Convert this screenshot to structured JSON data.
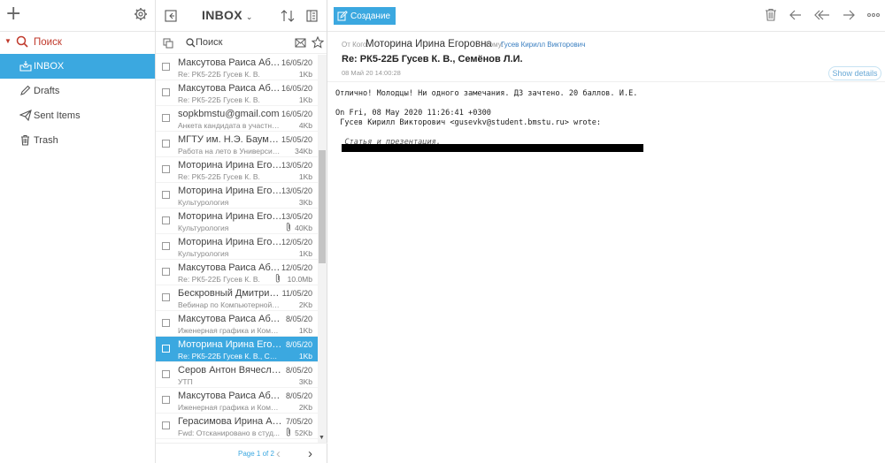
{
  "nav": {
    "search_label": "Поиск",
    "folders": [
      {
        "label": "INBOX",
        "icon": "inbox-icon",
        "active": true
      },
      {
        "label": "Drafts",
        "icon": "pencil-icon"
      },
      {
        "label": "Sent Items",
        "icon": "paper-plane-icon"
      },
      {
        "label": "Trash",
        "icon": "trash-icon"
      }
    ]
  },
  "list": {
    "title": "INBOX",
    "search_placeholder": "Поиск",
    "pager_text": "Page 1 of 2",
    "rows": [
      {
        "from": "Максутова Раиса Абдр...",
        "date": "16/05/20",
        "subject": "Re: РК5-22Б Гусев К. В.",
        "size": "1Kb"
      },
      {
        "from": "Максутова Раиса Абдр...",
        "date": "16/05/20",
        "subject": "Re: РК5-22Б Гусев К. В.",
        "size": "1Kb"
      },
      {
        "from": "sopkbmstu@gmail.com",
        "date": "16/05/20",
        "subject": "Анкета кандидата в участник...",
        "size": "4Kb"
      },
      {
        "from": "МГТУ им. Н.Э. Баумана",
        "date": "15/05/20",
        "subject": "Работа на лето в Университете",
        "size": "34Kb"
      },
      {
        "from": "Моторина Ирина Егоро...",
        "date": "13/05/20",
        "subject": "Re: РК5-22Б Гусев К. В.",
        "size": "1Kb"
      },
      {
        "from": "Моторина Ирина Егоро...",
        "date": "13/05/20",
        "subject": "Культурология",
        "size": "3Kb"
      },
      {
        "from": "Моторина Ирина Егоро...",
        "date": "13/05/20",
        "subject": "Культурология",
        "size": "40Kb",
        "attach": true
      },
      {
        "from": "Моторина Ирина Егоро...",
        "date": "12/05/20",
        "subject": "Культурология",
        "size": "1Kb"
      },
      {
        "from": "Максутова Раиса Абдр...",
        "date": "12/05/20",
        "subject": "Re: РК5-22Б Гусев К. В.",
        "size": "10.0Mb",
        "attach": true
      },
      {
        "from": "Бескровный Дмитрий В...",
        "date": "11/05/20",
        "subject": "Вебинар по Компьютерной гра...",
        "size": "2Kb"
      },
      {
        "from": "Максутова Раиса Абдр...",
        "date": "8/05/20",
        "subject": "Иженерная графика и Компьют...",
        "size": "1Kb"
      },
      {
        "from": "Моторина Ирина Егоро...",
        "date": "8/05/20",
        "subject": "Re: РК5-22Б Гусев К. В., Семён...",
        "size": "1Kb",
        "selected": true
      },
      {
        "from": "Серов Антон Вячеслав...",
        "date": "8/05/20",
        "subject": "УТП",
        "size": "3Kb"
      },
      {
        "from": "Максутова Раиса Абдр...",
        "date": "8/05/20",
        "subject": "Иженерная графика и Компьют...",
        "size": "2Kb"
      },
      {
        "from": "Герасимова Ирина Але...",
        "date": "7/05/20",
        "subject": "Fwd: Отсканировано в студ...",
        "size": "52Kb",
        "attach": true
      }
    ]
  },
  "read": {
    "compose_label": "Создание",
    "from_label": "От Кого:",
    "from_name": "Моторина Ирина Егоровна",
    "to_label": "Кому:",
    "to_name": "Гусев Кирилл Викторович",
    "show_details": "Show details",
    "subject": "Re: РК5-22Б Гусев К. В., Семёнов Л.И.",
    "date": "08 Май 20 14:00:28",
    "body_line1": "Отлично! Молодцы! Ни одного замечания. ДЗ зачтено. 20 баллов. И.Е.",
    "body_line2": "On Fri, 08 May 2020 11:26:41 +0300",
    "body_line3": " Гусев Кирилл Викторович <gusevkv@student.bmstu.ru> wrote:",
    "body_quote": "  Статья и презентация."
  },
  "colors": {
    "accent": "#3ba8e0",
    "search_red": "#c0392b"
  }
}
